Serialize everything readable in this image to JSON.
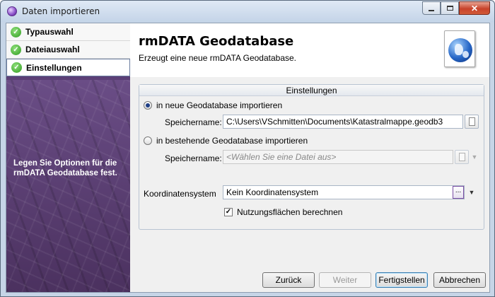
{
  "window": {
    "title": "Daten importieren",
    "controls": {
      "minimize": "–",
      "maximize": "□",
      "close": "✕"
    }
  },
  "steps": [
    {
      "label": "Typauswahl",
      "status": "done"
    },
    {
      "label": "Dateiauswahl",
      "status": "done"
    },
    {
      "label": "Einstellungen",
      "status": "active"
    }
  ],
  "sidebar": {
    "hint": "Legen Sie Optionen für die rmDATA Geodatabase fest."
  },
  "header": {
    "title": "rmDATA Geodatabase",
    "subtitle": "Erzeugt eine neue rmDATA Geodatabase.",
    "icon": "globe-icon"
  },
  "settings": {
    "group_caption": "Einstellungen",
    "new_db_radio": {
      "label": "in neue Geodatabase importieren",
      "selected": true
    },
    "new_db_save_label": "Speichername:",
    "new_db_save_value": "C:\\Users\\VSchmitten\\Documents\\Katastralmappe.geodb3",
    "existing_db_radio": {
      "label": "in bestehende Geodatabase importieren",
      "selected": false
    },
    "existing_db_save_label": "Speichername:",
    "existing_db_placeholder": "<Wählen Sie eine Datei aus>",
    "coord_label": "Koordinatensystem",
    "coord_value": "Kein Koordinatensystem",
    "coord_dots": "...",
    "usage_checkbox": {
      "label": "Nutzungsflächen berechnen",
      "checked": true,
      "mark": "✓"
    }
  },
  "buttons": {
    "back": "Zurück",
    "next": "Weiter",
    "finish": "Fertigstellen",
    "cancel": "Abbrechen"
  },
  "colors": {
    "sidebar_bg": "#5b3f76",
    "title_bg": "#c4d4e8",
    "close_btn": "#c8432a",
    "check_green": "#2f9b1f"
  }
}
